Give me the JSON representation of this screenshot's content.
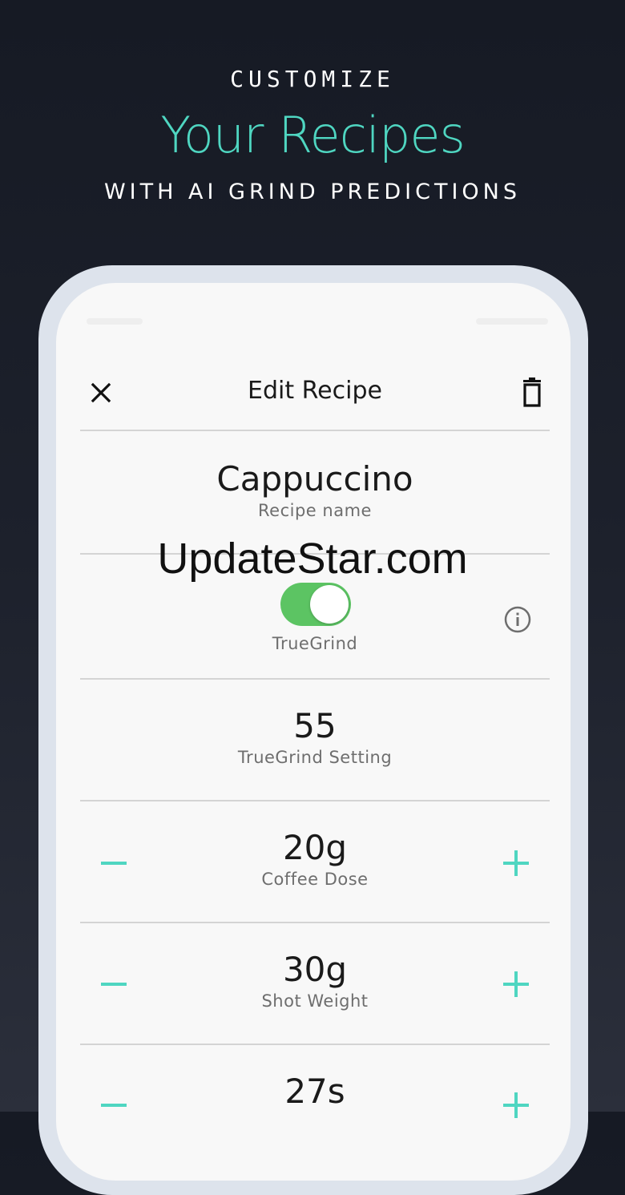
{
  "promo": {
    "line1": "CUSTOMIZE",
    "line2": "Your Recipes",
    "line3": "WITH AI GRIND PREDICTIONS"
  },
  "header": {
    "title": "Edit Recipe",
    "close_icon": "close-icon",
    "delete_icon": "trash-icon"
  },
  "recipe": {
    "name": "Cappuccino",
    "name_label": "Recipe name",
    "truegrind_label": "TrueGrind",
    "truegrind_enabled": true,
    "setting_value": "55",
    "setting_label": "TrueGrind Setting",
    "dose_value": "20g",
    "dose_label": "Coffee Dose",
    "weight_value": "30g",
    "weight_label": "Shot Weight",
    "time_value": "27s"
  },
  "watermark": "UpdateStar.com",
  "colors": {
    "accent": "#4fd6c1",
    "toggle_on": "#5cc463",
    "background": "#161a24"
  }
}
